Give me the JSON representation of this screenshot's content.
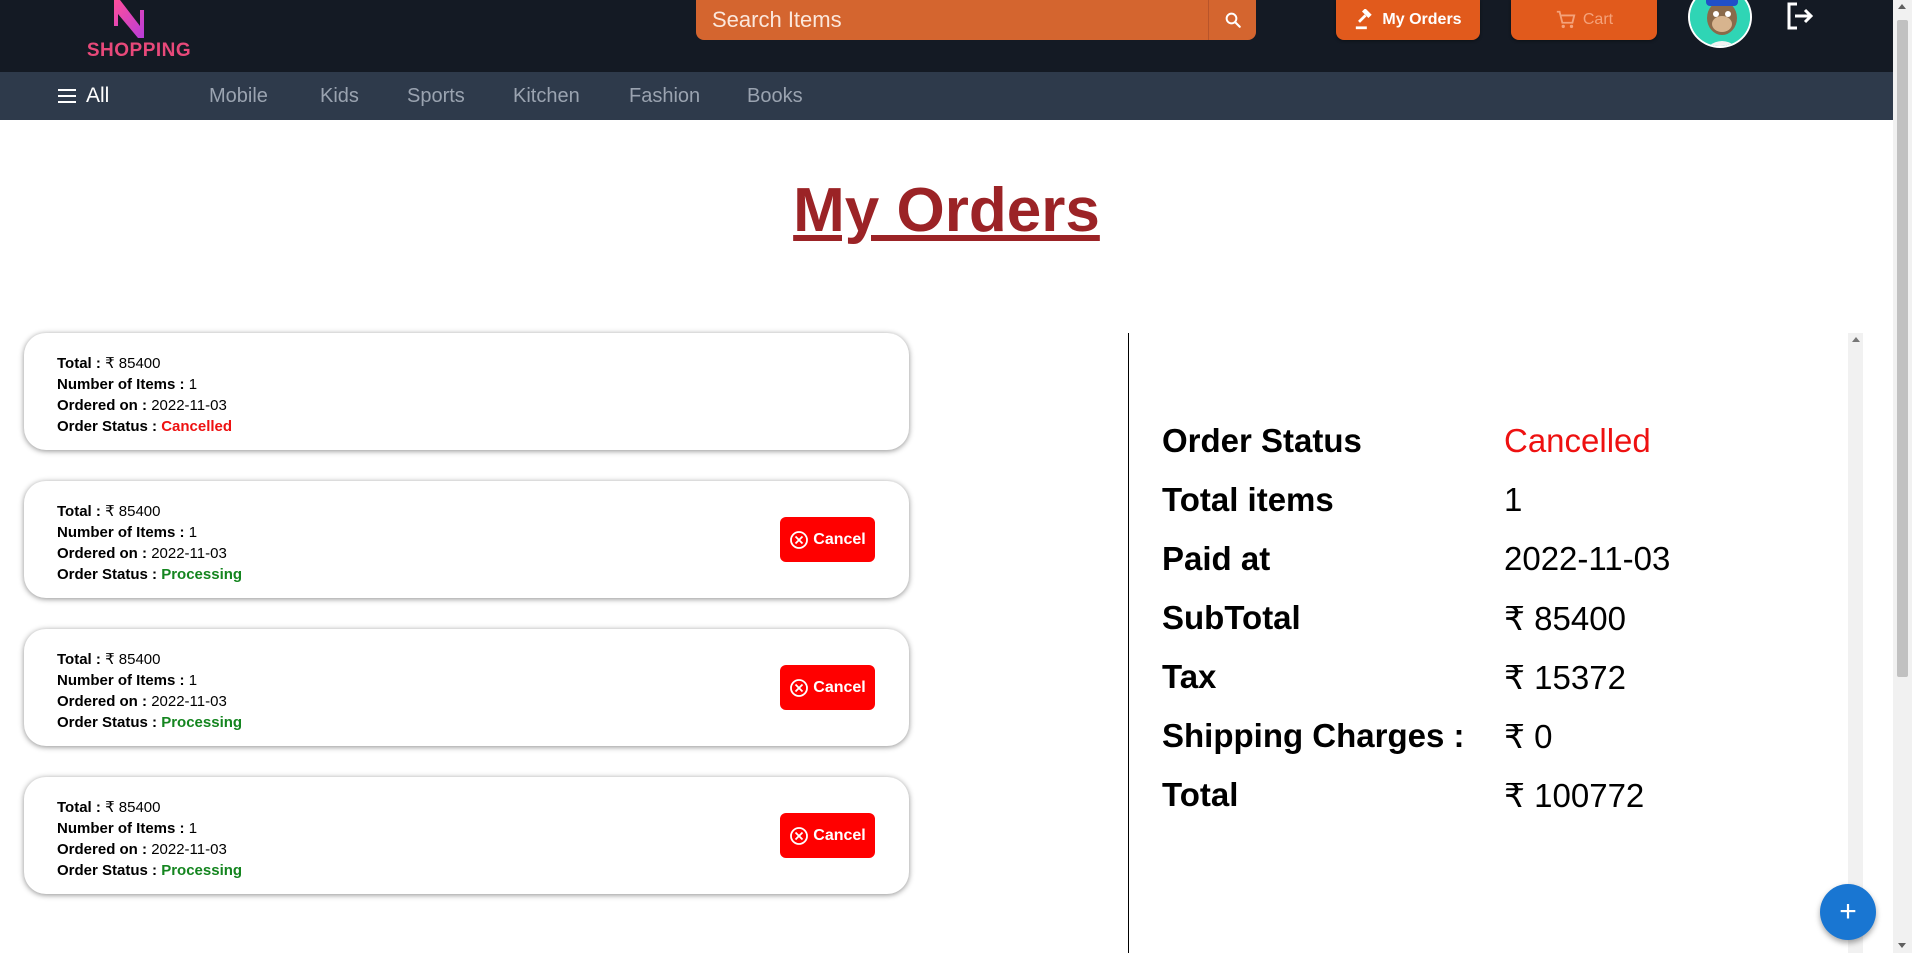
{
  "header": {
    "logo_text": "SHOPPING",
    "search": {
      "placeholder": "Search Items"
    },
    "my_orders_label": "My Orders",
    "cart_label": "Cart"
  },
  "categories": {
    "all_label": "All",
    "items": [
      "Mobile",
      "Kids",
      "Sports",
      "Kitchen",
      "Fashion",
      "Books"
    ]
  },
  "page": {
    "title": "My Orders"
  },
  "labels": {
    "total": "Total :",
    "items": "Number of Items :",
    "ordered_on": "Ordered on :",
    "status": "Order Status :",
    "cancel": "Cancel"
  },
  "orders": [
    {
      "total": "₹ 85400",
      "items": "1",
      "ordered_on": "2022-11-03",
      "status": "Cancelled"
    },
    {
      "total": "₹ 85400",
      "items": "1",
      "ordered_on": "2022-11-03",
      "status": "Processing"
    },
    {
      "total": "₹ 85400",
      "items": "1",
      "ordered_on": "2022-11-03",
      "status": "Processing"
    },
    {
      "total": "₹ 85400",
      "items": "1",
      "ordered_on": "2022-11-03",
      "status": "Processing"
    }
  ],
  "detail": {
    "rows": [
      {
        "label": "Order Status",
        "value": "Cancelled"
      },
      {
        "label": "Total items",
        "value": "1"
      },
      {
        "label": "Paid at",
        "value": "2022-11-03"
      },
      {
        "label": "SubTotal",
        "value": "₹ 85400"
      },
      {
        "label": "Tax",
        "value": "₹ 15372"
      },
      {
        "label": "Shipping Charges :",
        "value": "₹ 0"
      },
      {
        "label": "Total",
        "value": "₹ 100772"
      }
    ]
  },
  "fab": {
    "label": "+"
  },
  "colors": {
    "header_bg": "#141a24",
    "category_bg": "#2e3a4b",
    "accent_orange": "#e15a1c",
    "title_red": "#9b2326",
    "cancel_red": "#ff0000",
    "processing_green": "#14851f",
    "fab_blue": "#1976d2"
  },
  "icons": {
    "logo": "shopping-logo-icon",
    "search": "search-icon",
    "my_orders": "gavel-icon",
    "cart": "cart-icon",
    "logout": "logout-icon",
    "menu": "menu-icon",
    "cancel": "cancel-circle-icon",
    "fab": "plus-icon"
  }
}
